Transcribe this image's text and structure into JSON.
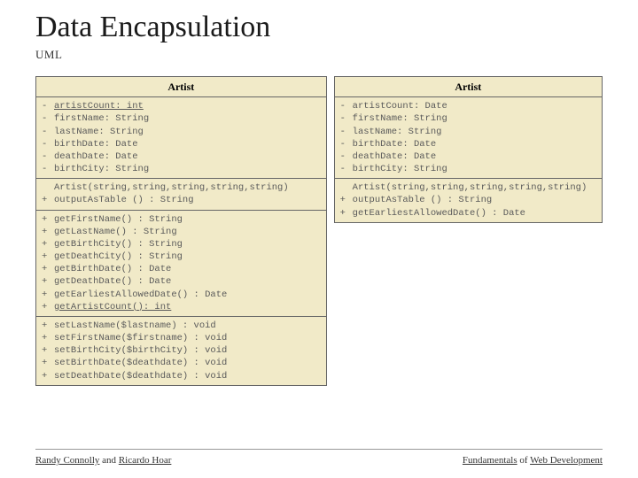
{
  "title": "Data Encapsulation",
  "subtitle": "UML",
  "classes": {
    "left": {
      "name": "Artist",
      "sections": [
        [
          {
            "vis": "-",
            "text": "artistCount: int",
            "static": true
          },
          {
            "vis": "-",
            "text": "firstName: String"
          },
          {
            "vis": "-",
            "text": "lastName: String"
          },
          {
            "vis": "-",
            "text": "birthDate: Date"
          },
          {
            "vis": "-",
            "text": "deathDate: Date"
          },
          {
            "vis": "-",
            "text": "birthCity: String"
          }
        ],
        [
          {
            "vis": "",
            "text": "Artist(string,string,string,string,string)"
          },
          {
            "vis": "+",
            "text": "outputAsTable () : String"
          }
        ],
        [
          {
            "vis": "+",
            "text": "getFirstName() : String"
          },
          {
            "vis": "+",
            "text": "getLastName() : String"
          },
          {
            "vis": "+",
            "text": "getBirthCity() : String"
          },
          {
            "vis": "+",
            "text": "getDeathCity() : String"
          },
          {
            "vis": "+",
            "text": "getBirthDate() : Date"
          },
          {
            "vis": "+",
            "text": "getDeathDate() : Date"
          },
          {
            "vis": "+",
            "text": "getEarliestAllowedDate() : Date"
          },
          {
            "vis": "+",
            "text": "getArtistCount(): int",
            "static": true
          }
        ],
        [
          {
            "vis": "+",
            "text": "setLastName($lastname) : void"
          },
          {
            "vis": "+",
            "text": "setFirstName($firstname) : void"
          },
          {
            "vis": "+",
            "text": "setBirthCity($birthCity) : void"
          },
          {
            "vis": "+",
            "text": "setBirthDate($deathdate) : void"
          },
          {
            "vis": "+",
            "text": "setDeathDate($deathdate) : void"
          }
        ]
      ]
    },
    "right": {
      "name": "Artist",
      "sections": [
        [
          {
            "vis": "-",
            "text": "artistCount: Date"
          },
          {
            "vis": "-",
            "text": "firstName: String"
          },
          {
            "vis": "-",
            "text": "lastName: String"
          },
          {
            "vis": "-",
            "text": "birthDate: Date"
          },
          {
            "vis": "-",
            "text": "deathDate: Date"
          },
          {
            "vis": "-",
            "text": "birthCity: String"
          }
        ],
        [
          {
            "vis": "",
            "text": "Artist(string,string,string,string,string)"
          },
          {
            "vis": "+",
            "text": "outputAsTable () : String"
          },
          {
            "vis": "+",
            "text": "getEarliestAllowedDate() : Date"
          }
        ]
      ]
    }
  },
  "footer": {
    "left_a": "Randy Connolly",
    "left_mid": " and ",
    "left_b": "Ricardo Hoar",
    "right_a": "Fundamentals",
    "right_mid": " of ",
    "right_b": "Web Development"
  }
}
